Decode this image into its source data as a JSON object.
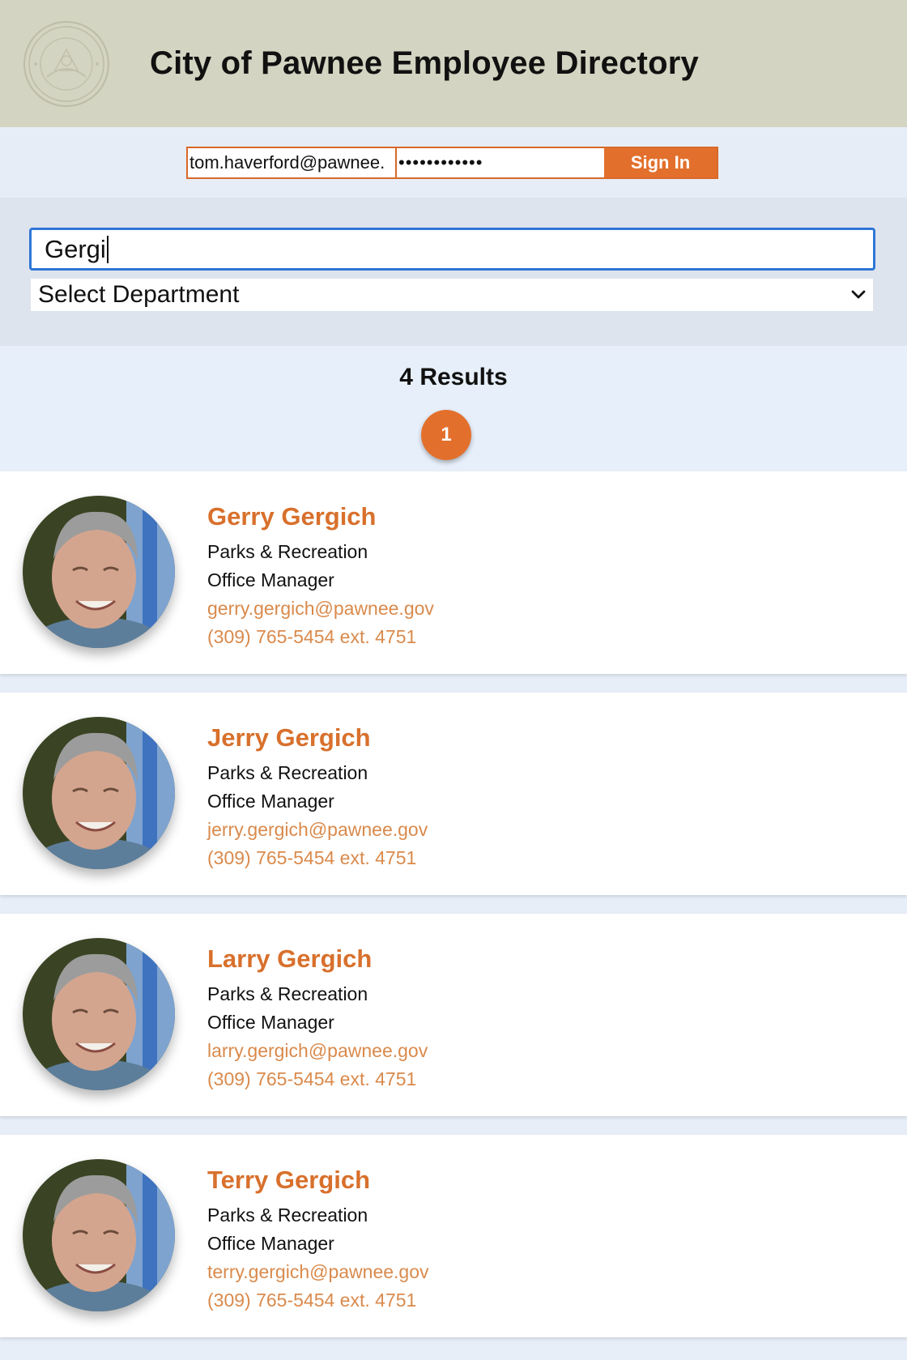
{
  "header": {
    "title": "City of Pawnee Employee Directory",
    "seal_icon": "city-seal-logo",
    "seal_text": "CITY OF PAWNEE INDIANA · 1817"
  },
  "signin": {
    "email_value": "tom.haverford@pawnee.",
    "password_value": "••••••••••••",
    "button_label": "Sign In"
  },
  "search": {
    "query": "Gergi",
    "department_selected": "Select Department",
    "dropdown_icon": "chevron-down-icon"
  },
  "results": {
    "count_label": "4 Results",
    "page_current": "1"
  },
  "employees": [
    {
      "name": "Gerry Gergich",
      "department": "Parks & Recreation",
      "title": "Office Manager",
      "email": "gerry.gergich@pawnee.gov",
      "phone": "(309) 765-5454 ext. 4751"
    },
    {
      "name": "Jerry Gergich",
      "department": "Parks & Recreation",
      "title": "Office Manager",
      "email": "jerry.gergich@pawnee.gov",
      "phone": "(309) 765-5454 ext. 4751"
    },
    {
      "name": "Larry Gergich",
      "department": "Parks & Recreation",
      "title": "Office Manager",
      "email": "larry.gergich@pawnee.gov",
      "phone": "(309) 765-5454 ext. 4751"
    },
    {
      "name": "Terry Gergich",
      "department": "Parks & Recreation",
      "title": "Office Manager",
      "email": "terry.gergich@pawnee.gov",
      "phone": "(309) 765-5454 ext. 4751"
    }
  ],
  "colors": {
    "accent": "#e2702c",
    "header_bg": "#d3d4c1",
    "focus_blue": "#2e76d6"
  }
}
